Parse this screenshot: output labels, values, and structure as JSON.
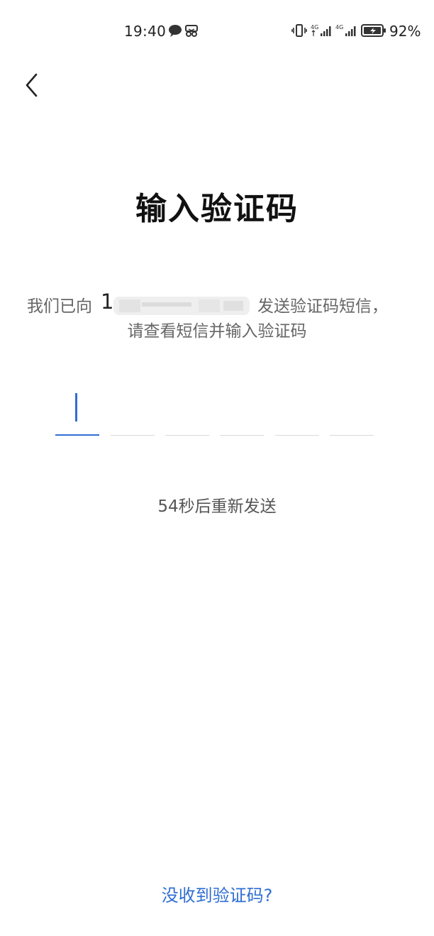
{
  "status_bar": {
    "time": "19:40",
    "battery_percent": "92%",
    "icons": [
      "message-icon",
      "scissors-icon",
      "vibrate-icon",
      "signal-4g-icon",
      "signal-4g-icon",
      "battery-icon"
    ]
  },
  "nav": {
    "back_icon": "chevron-left-icon"
  },
  "title": "输入验证码",
  "description": {
    "prefix": "我们已向",
    "phone_visible": "1",
    "suffix": "发送验证码短信，",
    "line2": "请查看短信并输入验证码"
  },
  "code_input": {
    "length": 6,
    "value": ""
  },
  "resend": {
    "text": "54秒后重新发送"
  },
  "no_code_link": "没收到验证码?",
  "colors": {
    "accent": "#2f6ed3",
    "muted_text": "#666666",
    "title_text": "#111111"
  }
}
